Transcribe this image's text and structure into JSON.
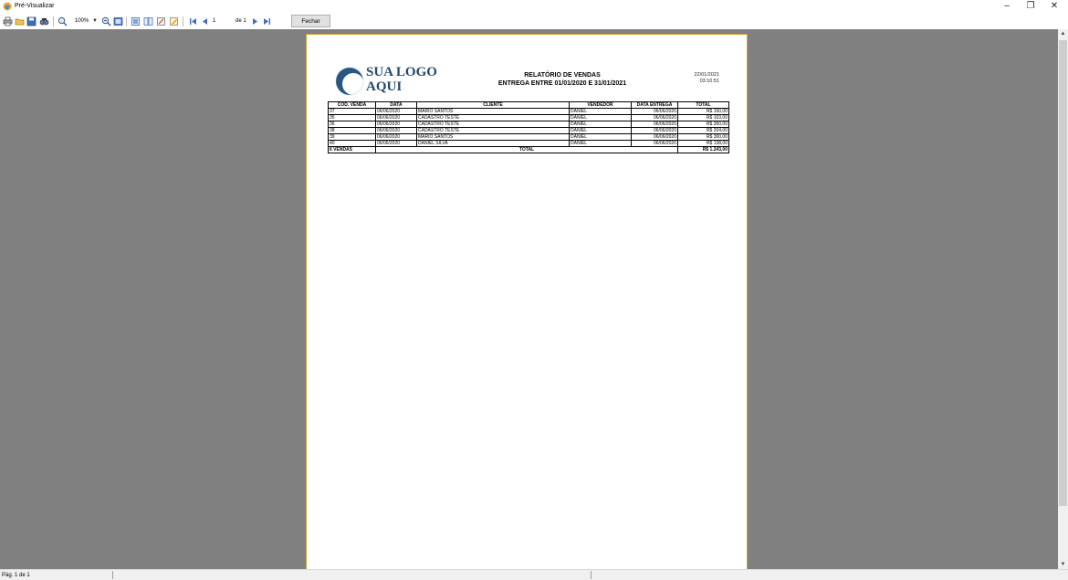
{
  "window": {
    "title": "Pré-Visualizar",
    "minimize": "–",
    "restore": "❐",
    "close": "✕"
  },
  "toolbar": {
    "icons": [
      "printer-icon",
      "open-folder-icon",
      "save-icon",
      "find-icon",
      "zoom-icon",
      "zoom-dropdown",
      "zoom-out-icon",
      "page-width-icon",
      "single-page-icon",
      "two-pages-icon",
      "edit-page-icon",
      "page-setup-icon",
      "first-page-icon",
      "prev-page-icon",
      "next-page-icon",
      "last-page-icon"
    ],
    "zoom": "100%",
    "page_input": "1",
    "page_count": "de 1",
    "close_label": "Fechar"
  },
  "report": {
    "logo_line1": "SUA LOGO",
    "logo_line2": "AQUI",
    "title": "RELATÓRIO DE VENDAS",
    "subtitle": "ENTREGA ENTRE 01/01/2020 E 31/01/2021",
    "date": "22/01/2021",
    "time": "03:10:51",
    "columns": [
      "CÓD. VENDA",
      "DATA",
      "CLIENTE",
      "VENDEDOR",
      "DATA ENTREGA",
      "TOTAL"
    ],
    "rows": [
      [
        "37",
        "06/06/2020",
        "MARIO SANTOS",
        "DANIEL",
        "06/06/2020",
        "R$ 150,00"
      ],
      [
        "35",
        "06/06/2020",
        "CADASTRO TESTE",
        "DANIEL",
        "06/06/2020",
        "R$ 103,00"
      ],
      [
        "36",
        "06/06/2020",
        "CADASTRO TESTE",
        "DANIEL",
        "06/06/2020",
        "R$ 350,00"
      ],
      [
        "38",
        "06/06/2020",
        "CADASTRO TESTE",
        "DANIEL",
        "06/06/2020",
        "R$ 204,00"
      ],
      [
        "39",
        "06/06/2020",
        "MARIO SANTOS",
        "DANIEL",
        "06/06/2020",
        "R$ 300,00"
      ],
      [
        "40",
        "06/06/2020",
        "DANIEL SILVA",
        "DANIEL",
        "06/06/2020",
        "R$ 138,00"
      ]
    ],
    "footer_count": "6 VENDAS",
    "footer_label": "TOTAL",
    "footer_total": "R$ 1.243,00"
  },
  "colors": {
    "viewer_bg": "#808080",
    "page_border": "#c9a227",
    "logo": "#234a6e"
  },
  "status": {
    "page": "Pág. 1 de 1"
  }
}
